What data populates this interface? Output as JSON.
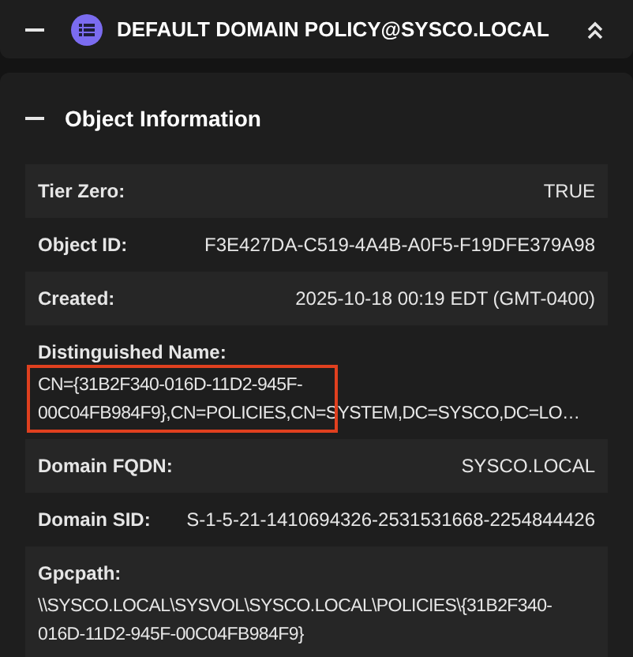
{
  "header": {
    "title": "DEFAULT DOMAIN POLICY@SYSCO.LOCAL"
  },
  "section": {
    "title": "Object Information",
    "expanded": true
  },
  "rows": [
    {
      "kind": "inline",
      "label": "Tier Zero:",
      "value": "TRUE"
    },
    {
      "kind": "inline",
      "label": "Object ID:",
      "value": "F3E427DA-C519-4A4B-A0F5-F19DFE379A98"
    },
    {
      "kind": "inline",
      "label": "Created:",
      "value": "2025-10-18 00:19 EDT (GMT-0400)"
    },
    {
      "kind": "block",
      "label": "Distinguished Name:",
      "value_lines": [
        "CN={31B2F340-016D-11D2-945F-",
        "00C04FB984F9},CN=POLICIES,CN=SYSTEM,DC=SYSCO,DC=LO…"
      ],
      "highlighted": true
    },
    {
      "kind": "inline",
      "label": "Domain FQDN:",
      "value": "SYSCO.LOCAL"
    },
    {
      "kind": "inline",
      "label": "Domain SID:",
      "value": "S-1-5-21-1410694326-2531531668-2254844426"
    },
    {
      "kind": "block",
      "label": "Gpcpath:",
      "value_lines": [
        "\\\\SYSCO.LOCAL\\SYSVOL\\SYSCO.LOCAL\\POLICIES\\{31B2F340-",
        "016D-11D2-945F-00C04FB984F9}"
      ],
      "highlighted": false
    }
  ]
}
